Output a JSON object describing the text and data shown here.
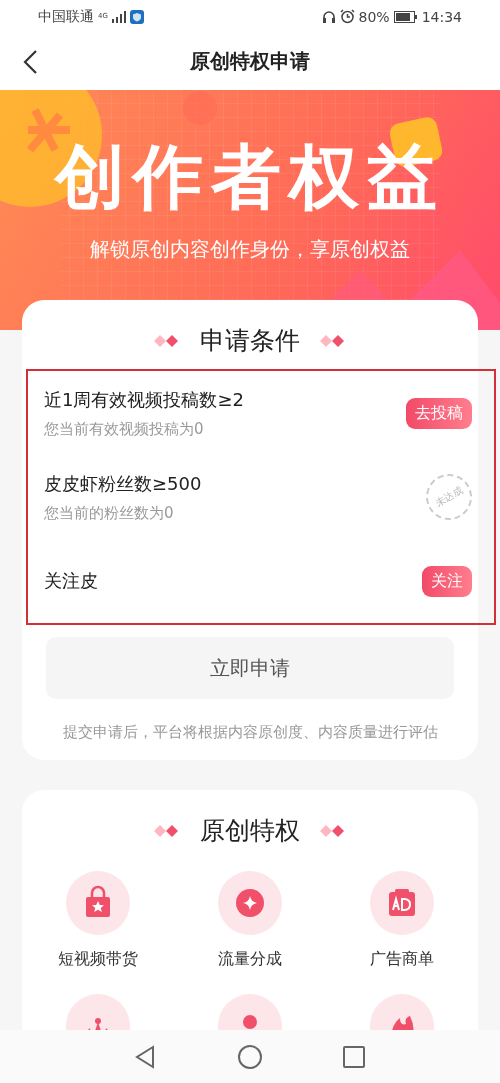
{
  "status_bar": {
    "carrier": "中国联通",
    "network": "4G",
    "battery": "80%",
    "time": "14:34"
  },
  "nav": {
    "title": "原创特权申请"
  },
  "banner": {
    "title": "创作者权益",
    "subtitle": "解锁原创内容创作身份，享原创权益"
  },
  "conditions": {
    "title": "申请条件",
    "highlighted": true,
    "items": [
      {
        "kind": "button",
        "label": "近1周有效视频投稿数≥2",
        "detail": "您当前有效视频投稿为0",
        "action": "去投稿"
      },
      {
        "kind": "stamp",
        "label": "皮皮虾粉丝数≥500",
        "detail": "您当前的粉丝数为0",
        "action": "未达成"
      },
      {
        "kind": "button",
        "label": "关注皮",
        "action": "关注"
      }
    ]
  },
  "apply_button": "立即申请",
  "note": "提交申请后，平台将根据内容原创度、内容质量进行评估",
  "privileges": {
    "title": "原创特权",
    "items": [
      {
        "label": "短视频带货"
      },
      {
        "label": "流量分成"
      },
      {
        "label": "广告商单"
      }
    ]
  }
}
